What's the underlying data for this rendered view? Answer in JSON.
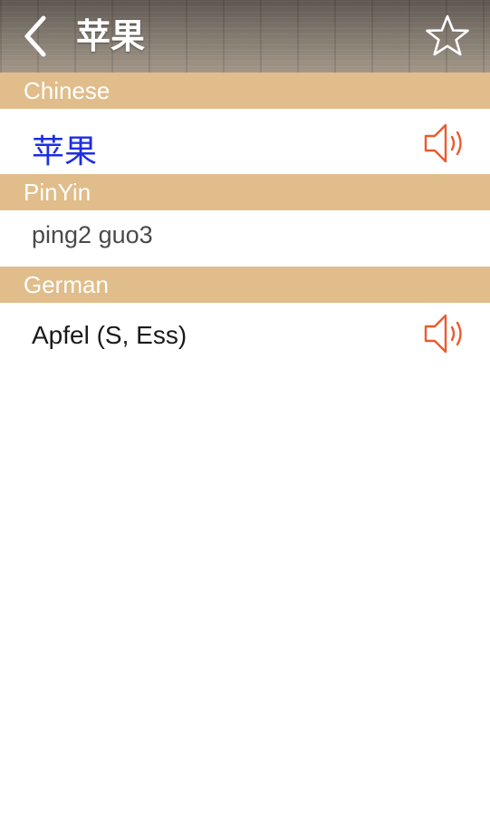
{
  "navbar": {
    "title": "苹果",
    "back_icon": "chevron-left-icon",
    "favorite_icon": "star-outline-icon"
  },
  "sections": {
    "chinese": {
      "header": "Chinese",
      "value": "苹果",
      "audio_icon": "speaker-icon"
    },
    "pinyin": {
      "header": "PinYin",
      "value": "ping2 guo3"
    },
    "german": {
      "header": "German",
      "value": "Apfel (S, Ess)",
      "audio_icon": "speaker-icon"
    }
  },
  "colors": {
    "section_header_bg": "#e0bd8a",
    "chinese_text": "#1d2ee0",
    "speaker_icon": "#ec5a2e"
  }
}
